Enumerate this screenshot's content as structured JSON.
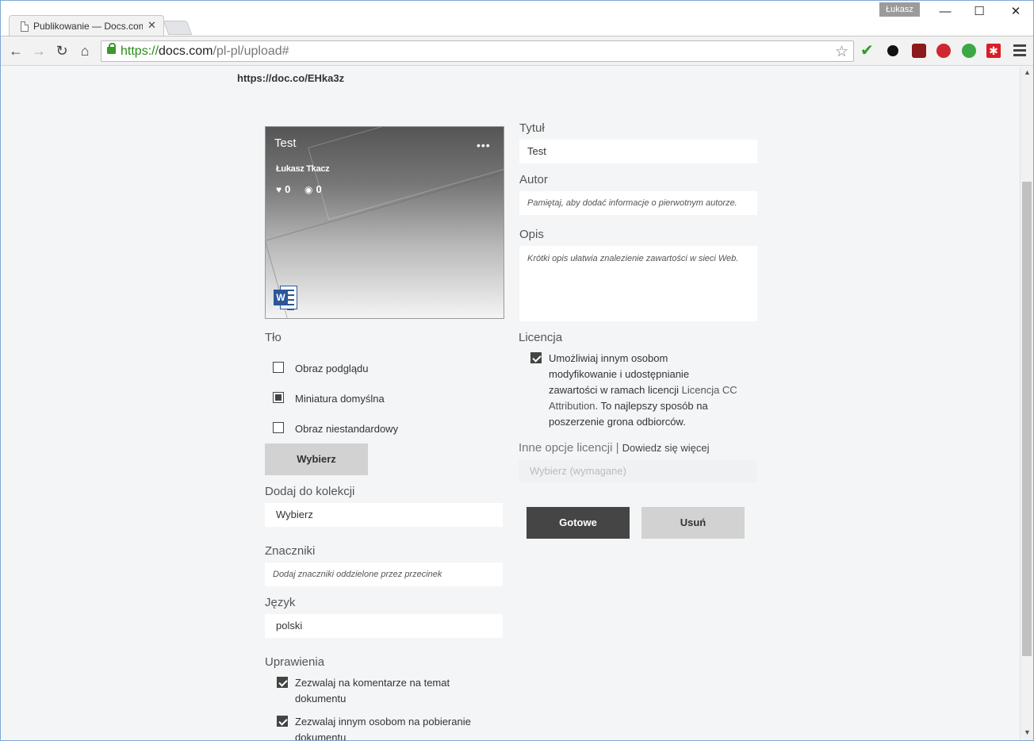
{
  "browser": {
    "tab_title": "Publikowanie — Docs.com",
    "profile_name": "Łukasz",
    "url_scheme": "https://",
    "url_host": "docs.com",
    "url_path": "/pl-pl/upload#"
  },
  "page": {
    "short_link": "https://doc.co/EHka3z",
    "thumbnail": {
      "title": "Test",
      "author": "Łukasz Tkacz",
      "likes": "0",
      "views": "0"
    },
    "left": {
      "background_label": "Tło",
      "background_options": [
        "Obraz podglądu",
        "Miniatura domyślna",
        "Obraz niestandardowy"
      ],
      "choose_button": "Wybierz",
      "collection_label": "Dodaj do kolekcji",
      "collection_value": "Wybierz",
      "tags_label": "Znaczniki",
      "tags_placeholder": "Dodaj znaczniki oddzielone przez przecinek",
      "language_label": "Język",
      "language_value": "polski",
      "permissions_label": "Uprawienia",
      "permission_comments_1": "Zezwalaj na komentarze na temat",
      "permission_comments_2": "dokumentu",
      "permission_download_1": "Zezwalaj innym osobom na pobieranie",
      "permission_download_2": "dokumentu"
    },
    "right": {
      "title_label": "Tytuł",
      "title_value": "Test",
      "author_label": "Autor",
      "author_placeholder": "Pamiętaj, aby dodać informacje o pierwotnym autorze.",
      "description_label": "Opis",
      "description_placeholder": "Krótki opis ułatwia znalezienie zawartości w sieci Web.",
      "license_label": "Licencja",
      "license_line1": "Umożliwiaj innym osobom",
      "license_line2": "modyfikowanie i udostępnianie",
      "license_line3_text": "zawartości w ramach licencji ",
      "license_line3_link": "Licencja CC",
      "license_line4_link": "Attribution",
      "license_line4_text": ". To najlepszy sposób na",
      "license_line5": "poszerzenie grona odbiorców.",
      "other_options_label": "Inne opcje licencji",
      "separator": "|",
      "learn_more": "Dowiedz się więcej",
      "license_select_placeholder": "Wybierz (wymagane)",
      "done_button": "Gotowe",
      "delete_button": "Usuń"
    }
  }
}
